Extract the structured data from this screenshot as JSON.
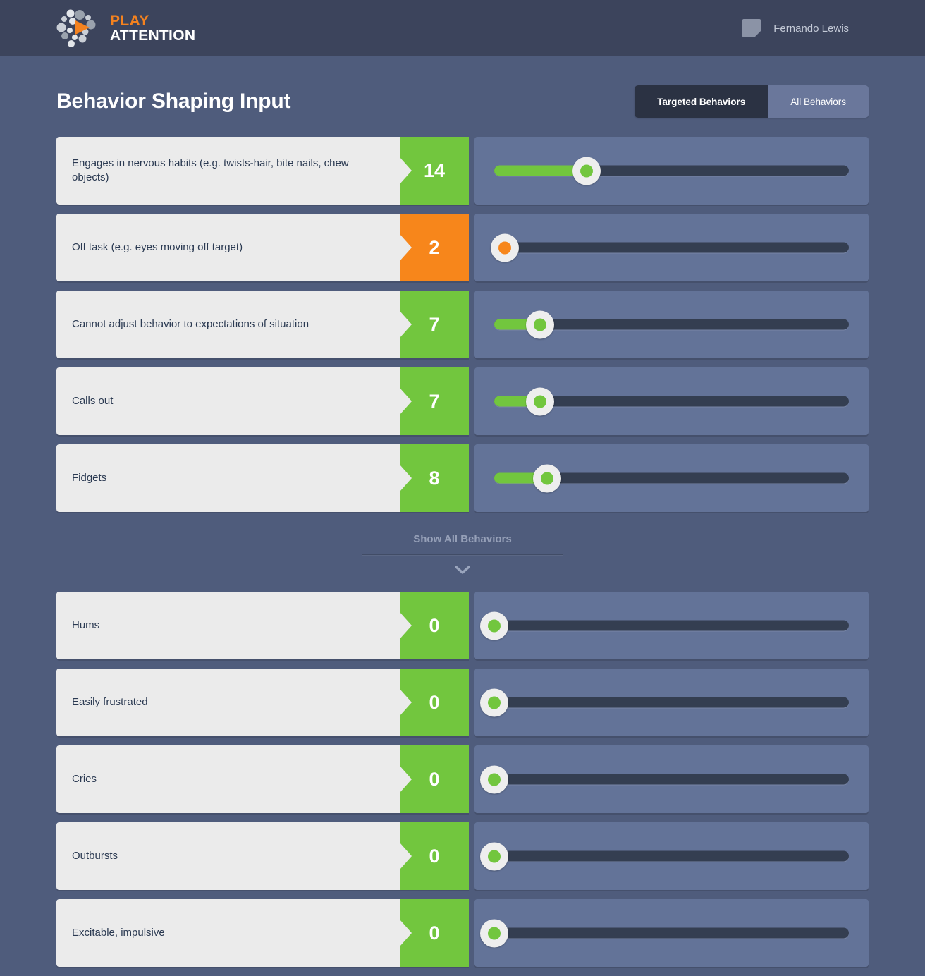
{
  "header": {
    "brand": {
      "line1": "PLAY",
      "line2": "ATTENTION"
    },
    "user": {
      "name": "Fernando Lewis",
      "avatar_icon": "note-avatar-icon"
    }
  },
  "page": {
    "title": "Behavior Shaping Input",
    "view_toggle": {
      "options": [
        {
          "label": "Targeted Behaviors",
          "active": true
        },
        {
          "label": "All Behaviors",
          "active": false
        }
      ]
    }
  },
  "targeted_behaviors": [
    {
      "label": "Engages in nervous habits (e.g. twists-hair, bite nails, chew objects)",
      "value": "14",
      "color": "green",
      "fill_pct": 26,
      "handle_pct": 26
    },
    {
      "label": "Off task (e.g. eyes moving off target)",
      "value": "2",
      "color": "orange",
      "fill_pct": 0,
      "handle_pct": 3
    },
    {
      "label": "Cannot adjust behavior to expectations of situation",
      "value": "7",
      "color": "green",
      "fill_pct": 13,
      "handle_pct": 13
    },
    {
      "label": "Calls out",
      "value": "7",
      "color": "green",
      "fill_pct": 13,
      "handle_pct": 13
    },
    {
      "label": "Fidgets",
      "value": "8",
      "color": "green",
      "fill_pct": 15,
      "handle_pct": 15
    }
  ],
  "show_all": {
    "label": "Show All Behaviors",
    "chevron_icon": "chevron-down-icon"
  },
  "all_behaviors": [
    {
      "label": "Hums",
      "value": "0",
      "color": "green",
      "fill_pct": 0,
      "handle_pct": 0
    },
    {
      "label": "Easily frustrated",
      "value": "0",
      "color": "green",
      "fill_pct": 0,
      "handle_pct": 0
    },
    {
      "label": "Cries",
      "value": "0",
      "color": "green",
      "fill_pct": 0,
      "handle_pct": 0
    },
    {
      "label": "Outbursts",
      "value": "0",
      "color": "green",
      "fill_pct": 0,
      "handle_pct": 0
    },
    {
      "label": "Excitable, impulsive",
      "value": "0",
      "color": "green",
      "fill_pct": 0,
      "handle_pct": 0
    }
  ],
  "colors": {
    "header_bg": "#3c445c",
    "page_bg": "#4f5c7c",
    "green": "#72c63e",
    "orange": "#f7861b",
    "label_bg": "#ebebeb",
    "slider_panel": "#637398",
    "slider_track": "#343e51",
    "accent_brand": "#f4821f"
  }
}
